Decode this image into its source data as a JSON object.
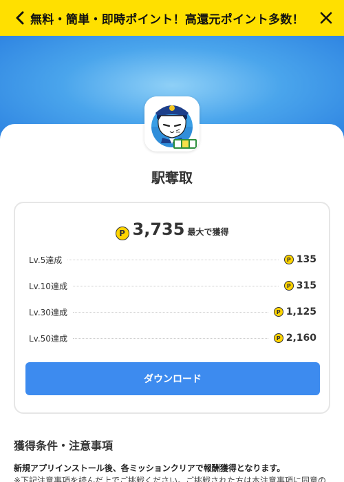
{
  "banner": {
    "title": "無料・簡単・即時ポイント！高還元ポイント多数！",
    "back_icon": "chevron-left-icon",
    "close_icon": "close-icon",
    "background": "#ffe000"
  },
  "app": {
    "name": "駅奪取",
    "icon": "cat-station-master-icon"
  },
  "reward": {
    "coin_symbol": "P",
    "total_amount": "3,735",
    "total_unit": "最大で獲得",
    "levels": [
      {
        "label": "Lv.5達成",
        "points": "135"
      },
      {
        "label": "Lv.10達成",
        "points": "315"
      },
      {
        "label": "Lv.30達成",
        "points": "1,125"
      },
      {
        "label": "Lv.50達成",
        "points": "2,160"
      }
    ]
  },
  "download": {
    "label": "ダウンロード",
    "color": "#3d8bef"
  },
  "conditions": {
    "title": "獲得条件・注意事項",
    "line1": "新規アプリインストール後、各ミッションクリアで報酬獲得となります。",
    "line2": "※下記注意事項を読んだ上でご挑戦ください。ご挑戦された方は本注意事項に同意の"
  }
}
